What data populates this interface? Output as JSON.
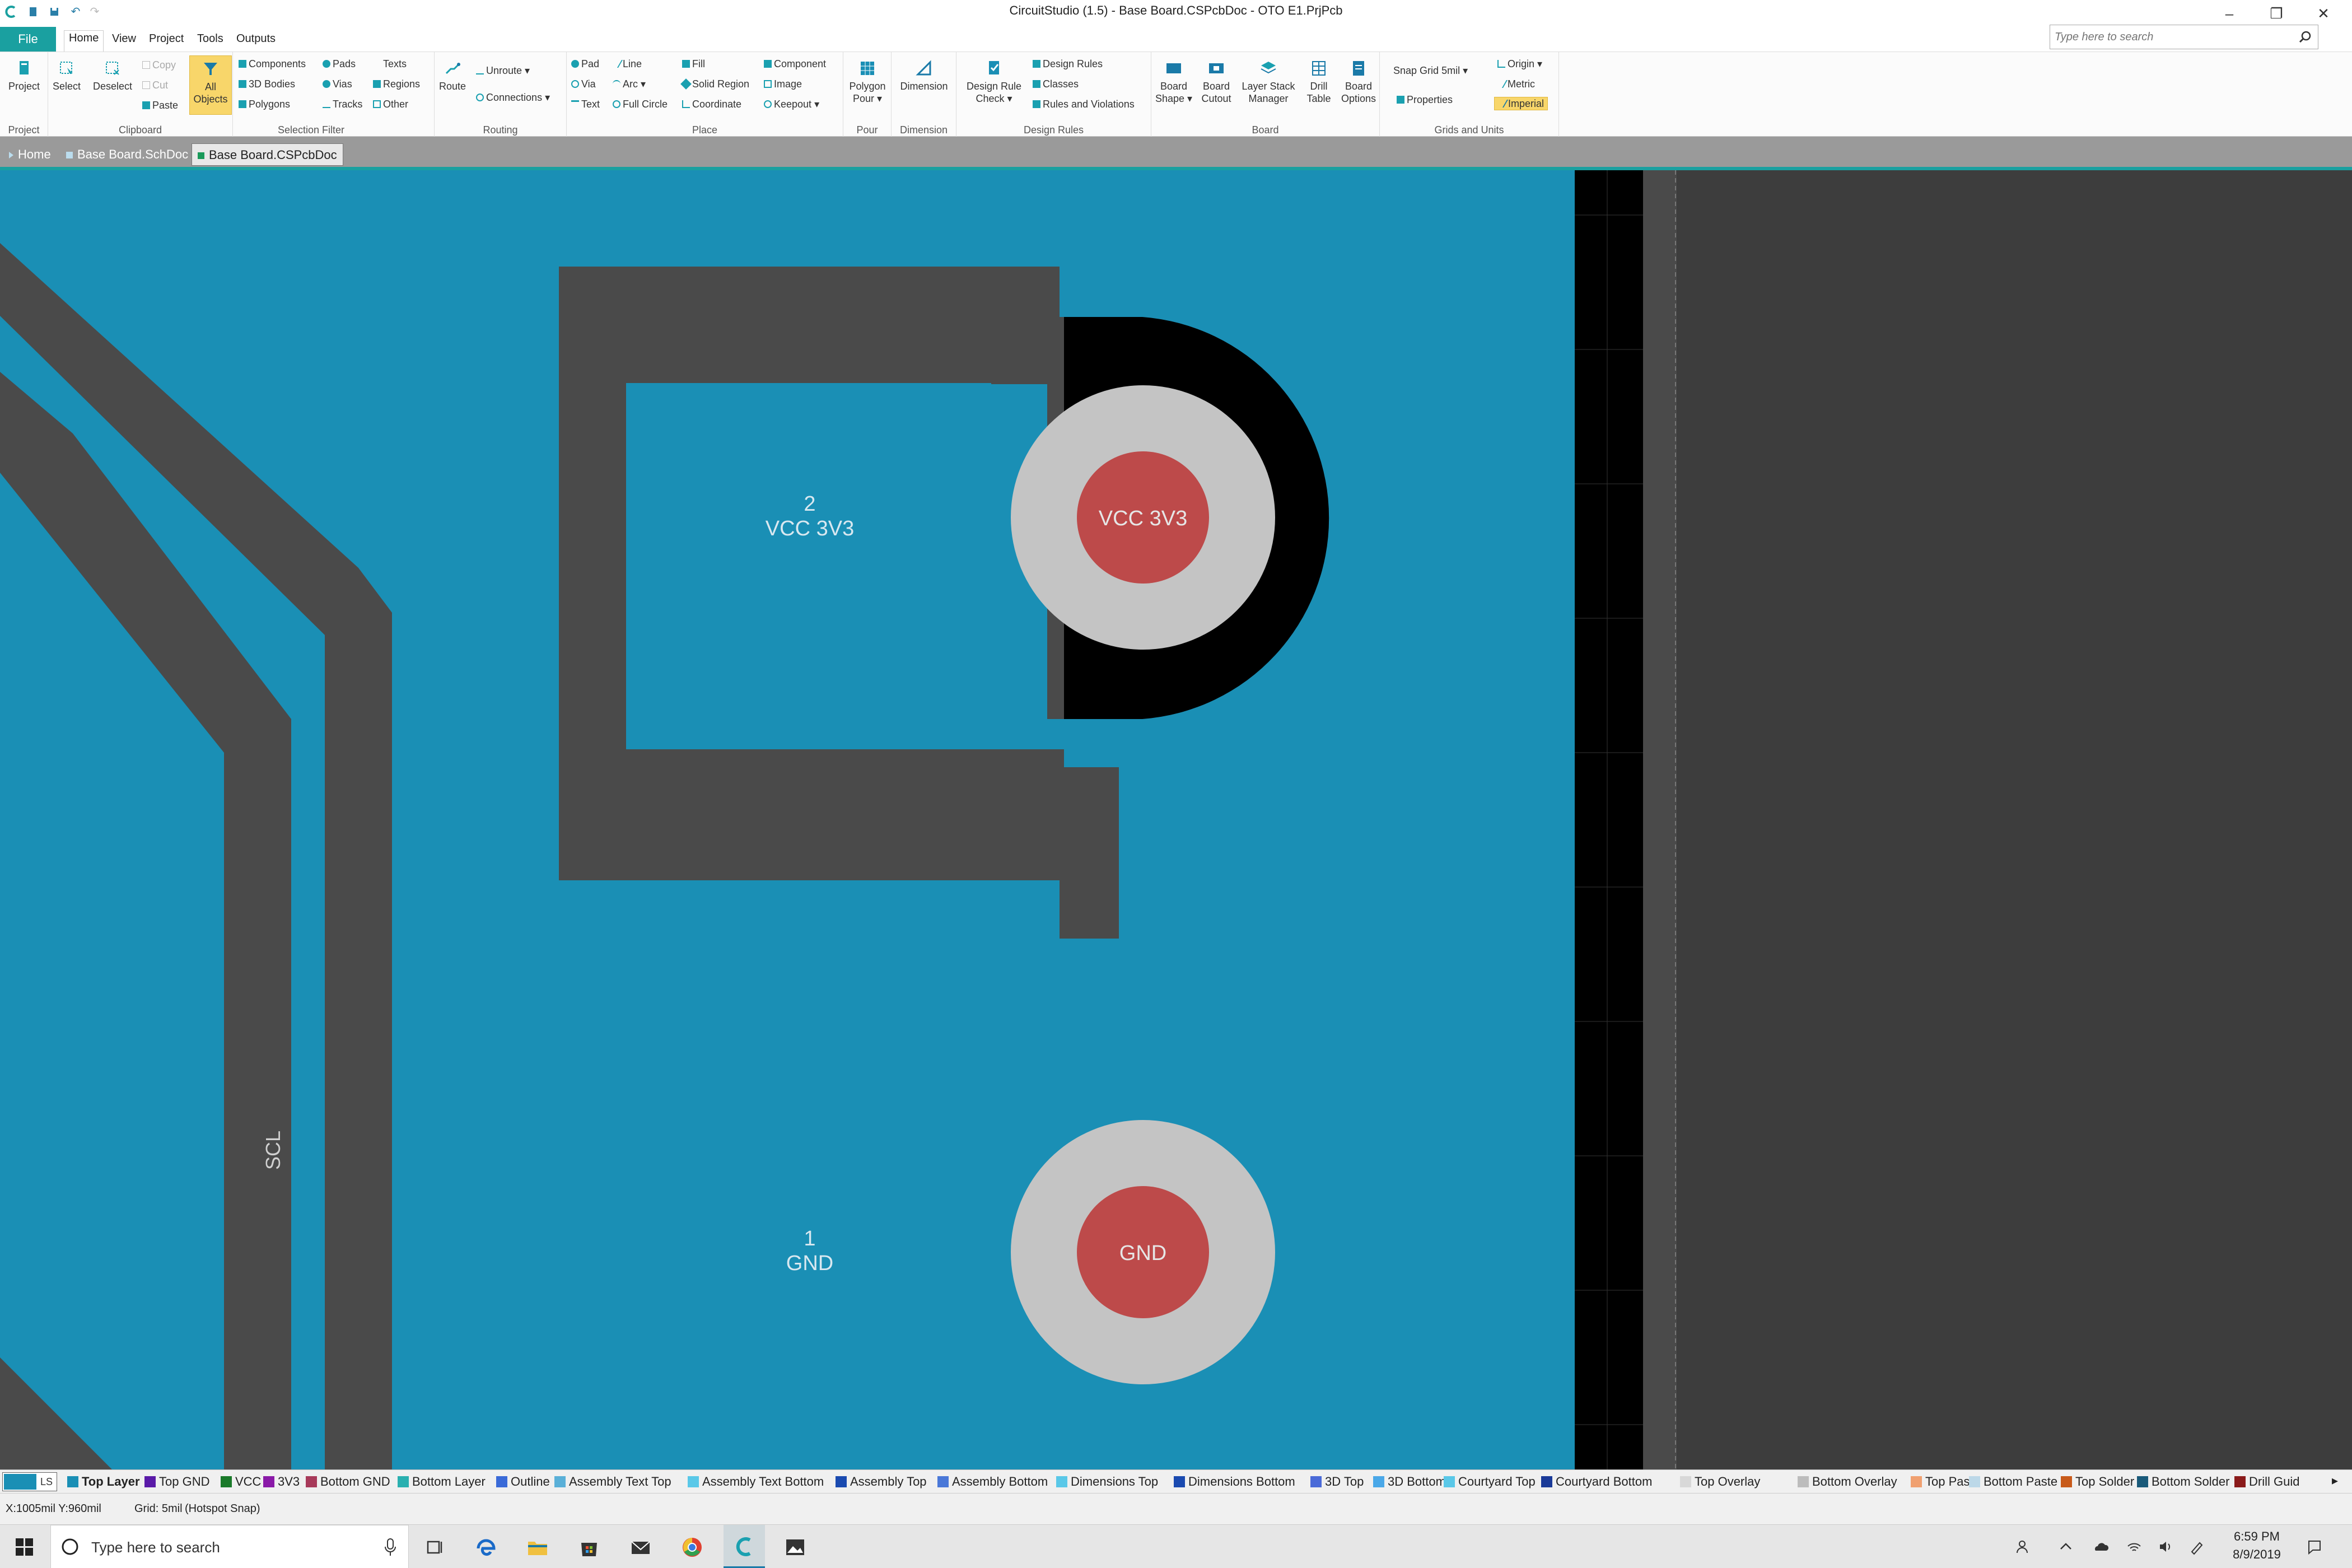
{
  "window": {
    "title": "CircuitStudio (1.5) - Base Board.CSPcbDoc - OTO E1.PrjPcb",
    "minimize": "–",
    "restore": "❐",
    "close": "✕"
  },
  "menu": {
    "file": "File",
    "tabs": [
      "Home",
      "View",
      "Project",
      "Tools",
      "Outputs"
    ],
    "search_placeholder": "Type here to search"
  },
  "ribbon": {
    "project": {
      "label": "Project",
      "group": "Project"
    },
    "clipboard": {
      "select": "Select",
      "deselect": "Deselect",
      "copy": "Copy",
      "cut": "Cut",
      "paste": "Paste",
      "group": "Clipboard"
    },
    "selection_filter": {
      "all_objects": [
        "All",
        "Objects"
      ],
      "components": "Components",
      "bodies": "3D Bodies",
      "polygons": "Polygons",
      "pads": "Pads",
      "vias": "Vias",
      "tracks": "Tracks",
      "texts": "Texts",
      "regions": "Regions",
      "other": "Other",
      "group": "Selection Filter"
    },
    "routing": {
      "route": "Route",
      "unroute": "Unroute",
      "connections": "Connections",
      "group": "Routing"
    },
    "place": {
      "pad": "Pad",
      "via": "Via",
      "text": "Text",
      "line": "Line",
      "arc": "Arc",
      "full_circle": "Full Circle",
      "fill": "Fill",
      "solid_region": "Solid Region",
      "coordinate": "Coordinate",
      "component": "Component",
      "image": "Image",
      "keepout": "Keepout",
      "group": "Place"
    },
    "pour": {
      "polygon_pour": [
        "Polygon",
        "Pour"
      ],
      "group": "Pour"
    },
    "dimension": {
      "dimension": "Dimension",
      "group": "Dimension"
    },
    "design_rules": {
      "drc": [
        "Design Rule",
        "Check"
      ],
      "design_rules": "Design Rules",
      "classes": "Classes",
      "rules_violations": "Rules and Violations",
      "group": "Design Rules"
    },
    "board": {
      "shape": [
        "Board",
        "Shape"
      ],
      "cutout": [
        "Board",
        "Cutout"
      ],
      "layer_stack": [
        "Layer Stack",
        "Manager"
      ],
      "drill": [
        "Drill",
        "Table"
      ],
      "options": [
        "Board",
        "Options"
      ],
      "group": "Board"
    },
    "grids": {
      "snap_grid": "Snap Grid",
      "snap_value": "5mil",
      "properties": "Properties",
      "origin": "Origin",
      "metric": "Metric",
      "imperial": "Imperial",
      "group": "Grids and Units"
    }
  },
  "doc_tabs": [
    "Home",
    "Base Board.SchDoc",
    "Base Board.CSPcbDoc"
  ],
  "pcb": {
    "pad2": {
      "number": "2",
      "net": "VCC 3V3",
      "pad_label": "VCC 3V3"
    },
    "pad1": {
      "number": "1",
      "net": "GND",
      "pad_label": "GND"
    },
    "trace_label": "SCL",
    "colors": {
      "copper": "#1a8fb5",
      "keepout": "#4a4a4a",
      "pad_ring": "#c4c4c4",
      "pad_hole": "#bd4a4a",
      "board_edge": "#000000"
    }
  },
  "layers": {
    "current": "LS",
    "items": [
      {
        "name": "Top Layer",
        "color": "#1a8fb5",
        "bold": true
      },
      {
        "name": "Top GND",
        "color": "#5a1aa8"
      },
      {
        "name": "VCC",
        "color": "#1a7a2a"
      },
      {
        "name": "3V3",
        "color": "#8a1aa8"
      },
      {
        "name": "Bottom GND",
        "color": "#a83a5a"
      },
      {
        "name": "Bottom Layer",
        "color": "#2ab0b0"
      },
      {
        "name": "Outline",
        "color": "#3a6ad8"
      },
      {
        "name": "Assembly Text Top",
        "color": "#5ab0d8"
      },
      {
        "name": "Assembly Text Bottom",
        "color": "#5ac8e8"
      },
      {
        "name": "Assembly Top",
        "color": "#1a4ab0"
      },
      {
        "name": "Assembly Bottom",
        "color": "#4a78d8"
      },
      {
        "name": "Dimensions Top",
        "color": "#5ac8e8"
      },
      {
        "name": "Dimensions Bottom",
        "color": "#1a4ab0"
      },
      {
        "name": "3D Top",
        "color": "#4a6ad8"
      },
      {
        "name": "3D Bottom",
        "color": "#4aa8e8"
      },
      {
        "name": "Courtyard Top",
        "color": "#5ac8e8"
      },
      {
        "name": "Courtyard Bottom",
        "color": "#1a3a98"
      },
      {
        "name": "Top Overlay",
        "color": "#d8d8d8"
      },
      {
        "name": "Bottom Overlay",
        "color": "#bcbcbc"
      },
      {
        "name": "Top Paste",
        "color": "#f0a070"
      },
      {
        "name": "Bottom Paste",
        "color": "#bcd8e8"
      },
      {
        "name": "Top Solder",
        "color": "#c85a1a"
      },
      {
        "name": "Bottom Solder",
        "color": "#1a5a7a"
      },
      {
        "name": "Drill Guid",
        "color": "#8a1a1a"
      }
    ]
  },
  "status": {
    "coords": "X:1005mil Y:960mil",
    "grid": "Grid: 5mil",
    "snap": "(Hotspot Snap)"
  },
  "taskbar": {
    "search": "Type here to search",
    "time": "6:59 PM",
    "date": "8/9/2019"
  }
}
